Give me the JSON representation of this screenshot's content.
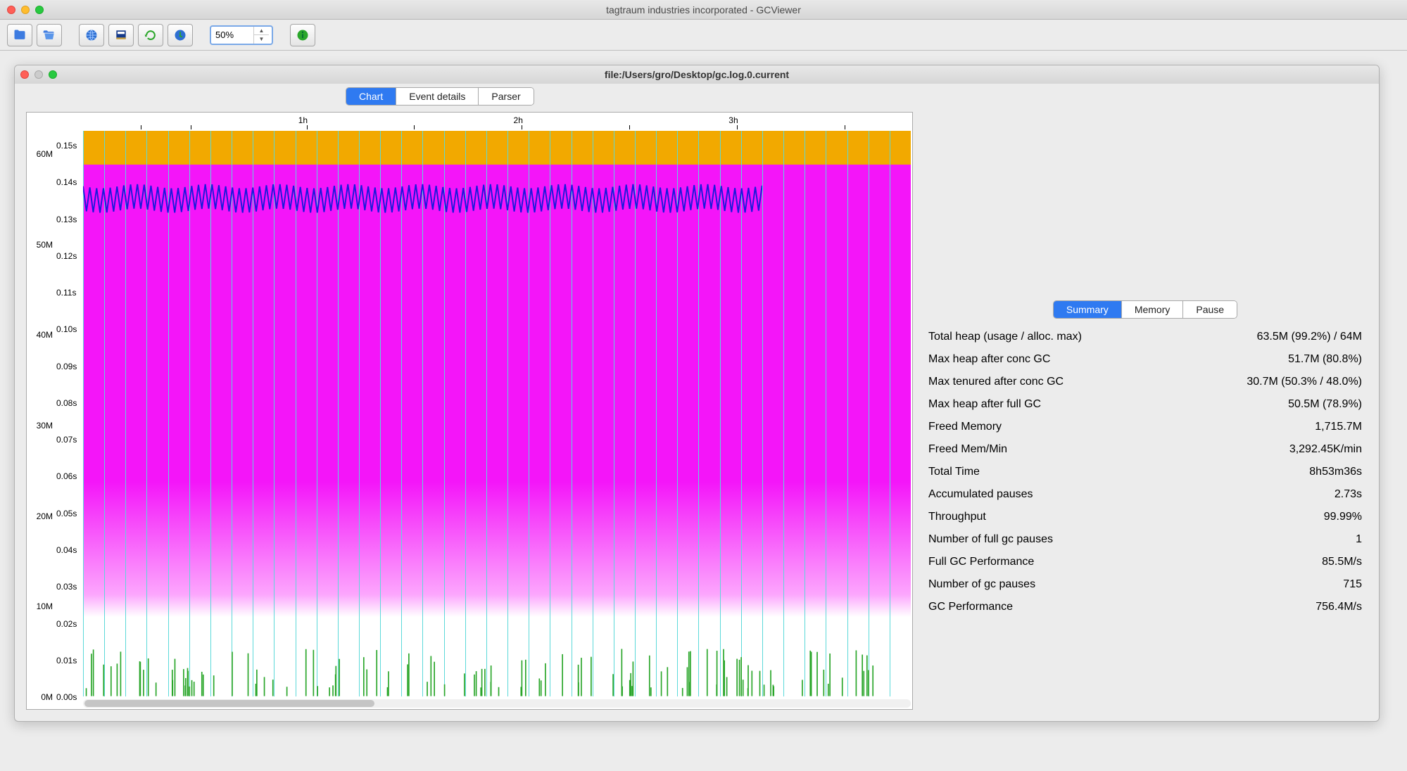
{
  "app": {
    "title": "tagtraum industries incorporated - GCViewer"
  },
  "toolbar": {
    "zoom_value": "50%"
  },
  "document": {
    "title": "file:/Users/gro/Desktop/gc.log.0.current"
  },
  "chart_tabs": {
    "tab1": "Chart",
    "tab2": "Event details",
    "tab3": "Parser"
  },
  "summary_tabs": {
    "tab1": "Summary",
    "tab2": "Memory",
    "tab3": "Pause"
  },
  "chart_data": {
    "type": "area",
    "title": "",
    "x_ticks": [
      "1h",
      "2h",
      "3h"
    ],
    "y_mem_ticks": [
      "0M",
      "10M",
      "20M",
      "30M",
      "40M",
      "50M",
      "60M"
    ],
    "y_time_ticks": [
      "0.00s",
      "0.01s",
      "0.02s",
      "0.03s",
      "0.04s",
      "0.05s",
      "0.06s",
      "0.07s",
      "0.08s",
      "0.09s",
      "0.10s",
      "0.11s",
      "0.12s",
      "0.13s",
      "0.14s",
      "0.15s"
    ],
    "heap_max_M": 64,
    "heap_usage_M": 63.5,
    "tenured_M": 55,
    "gc_event_count": 40,
    "used_after_gc_range_M": [
      50,
      52
    ],
    "gc_pause_s_approx": 0.005
  },
  "summary": [
    {
      "label": "Total heap (usage / alloc. max)",
      "value": "63.5M (99.2%) / 64M"
    },
    {
      "label": "Max heap after conc GC",
      "value": "51.7M (80.8%)"
    },
    {
      "label": "Max tenured after conc GC",
      "value": "30.7M (50.3% / 48.0%)"
    },
    {
      "label": "Max heap after full GC",
      "value": "50.5M (78.9%)"
    },
    {
      "label": "Freed Memory",
      "value": "1,715.7M"
    },
    {
      "label": "Freed Mem/Min",
      "value": "3,292.45K/min"
    },
    {
      "label": "Total Time",
      "value": "8h53m36s"
    },
    {
      "label": "Accumulated pauses",
      "value": "2.73s"
    },
    {
      "label": "Throughput",
      "value": "99.99%"
    },
    {
      "label": "Number of full gc pauses",
      "value": "1"
    },
    {
      "label": "Full GC Performance",
      "value": "85.5M/s"
    },
    {
      "label": "Number of gc pauses",
      "value": "715"
    },
    {
      "label": "GC Performance",
      "value": "756.4M/s"
    }
  ]
}
